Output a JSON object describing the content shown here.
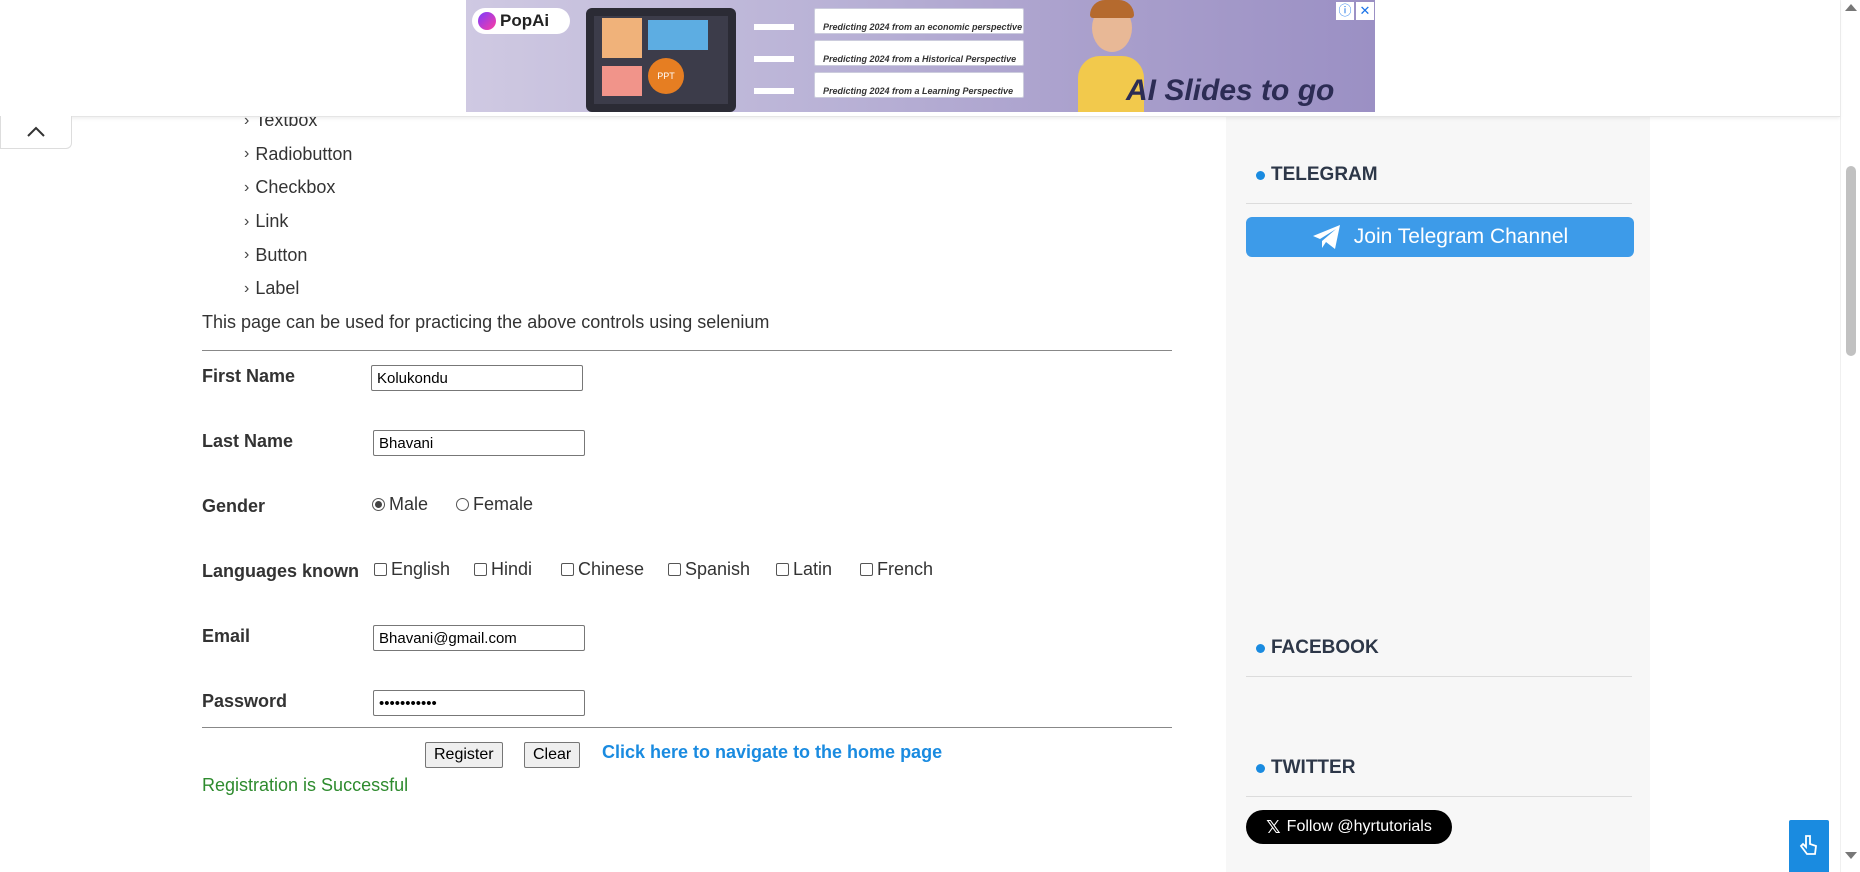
{
  "ad": {
    "brand": "PopAi",
    "cards": [
      "Predicting 2024 from an economic perspective",
      "Predicting 2024 from a Historical Perspective",
      "Predicting 2024 from a Learning Perspective"
    ],
    "laptop_label": "PPT",
    "tagline": "AI Slides to go"
  },
  "controls_list": [
    "Textbox",
    "Radiobutton",
    "Checkbox",
    "Link",
    "Button",
    "Label"
  ],
  "intro_text": "This page can be used for practicing the above controls using selenium",
  "form": {
    "first_name_label": "First Name",
    "first_name_value": "Kolukondu",
    "last_name_label": "Last Name",
    "last_name_value": "Bhavani",
    "gender_label": "Gender",
    "gender_options": [
      "Male",
      "Female"
    ],
    "languages_label": "Languages known",
    "languages": [
      "English",
      "Hindi",
      "Chinese",
      "Spanish",
      "Latin",
      "French"
    ],
    "email_label": "Email",
    "email_value": "Bhavani@gmail.com",
    "password_label": "Password",
    "password_value": "•••••••••••",
    "register_label": "Register",
    "clear_label": "Clear",
    "home_link": "Click here to navigate to the home page",
    "success_message": "Registration is Successful"
  },
  "sidebar": {
    "telegram_heading": "TELEGRAM",
    "telegram_button": "Join Telegram Channel",
    "facebook_heading": "FACEBOOK",
    "twitter_heading": "TWITTER",
    "follow_button": "Follow @hyrtutorials"
  },
  "colors": {
    "accent": "#1a8be0",
    "telegram": "#3d9be9",
    "success": "#2e8b2e"
  }
}
